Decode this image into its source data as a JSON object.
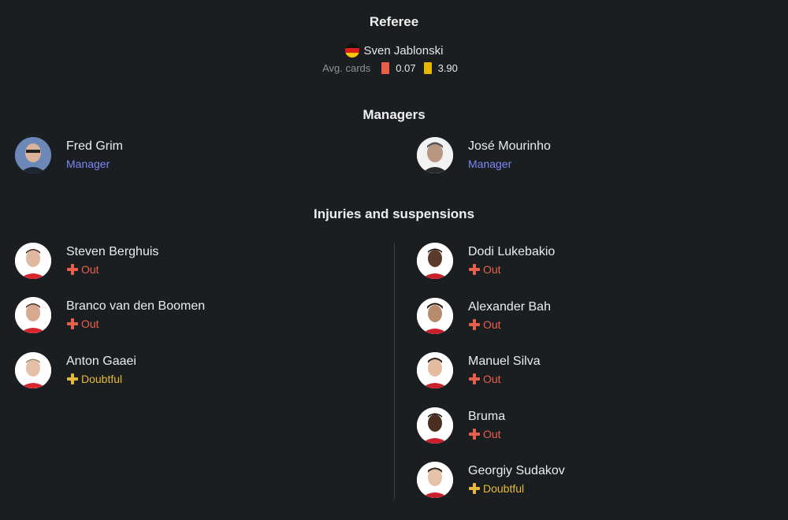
{
  "referee": {
    "title": "Referee",
    "name": "Sven Jablonski",
    "flag": "germany-flag",
    "avg_cards_label": "Avg. cards",
    "red_avg": "0.07",
    "yellow_avg": "3.90",
    "red_color": "#e8604c",
    "yellow_color": "#e7b600"
  },
  "managers": {
    "title": "Managers",
    "home": {
      "name": "Fred Grim",
      "role": "Manager"
    },
    "away": {
      "name": "José Mourinho",
      "role": "Manager"
    }
  },
  "injuries": {
    "title": "Injuries and suspensions",
    "home": [
      {
        "name": "Steven Berghuis",
        "status": "Out"
      },
      {
        "name": "Branco van den Boomen",
        "status": "Out"
      },
      {
        "name": "Anton Gaaei",
        "status": "Doubtful"
      }
    ],
    "away": [
      {
        "name": "Dodi Lukebakio",
        "status": "Out"
      },
      {
        "name": "Alexander Bah",
        "status": "Out"
      },
      {
        "name": "Manuel Silva",
        "status": "Out"
      },
      {
        "name": "Bruma",
        "status": "Out"
      },
      {
        "name": "Georgiy Sudakov",
        "status": "Doubtful"
      }
    ]
  },
  "colors": {
    "background": "#1b1e20",
    "out": "#e8604c",
    "doubtful": "#e7b93b",
    "role": "#7b88f5"
  }
}
